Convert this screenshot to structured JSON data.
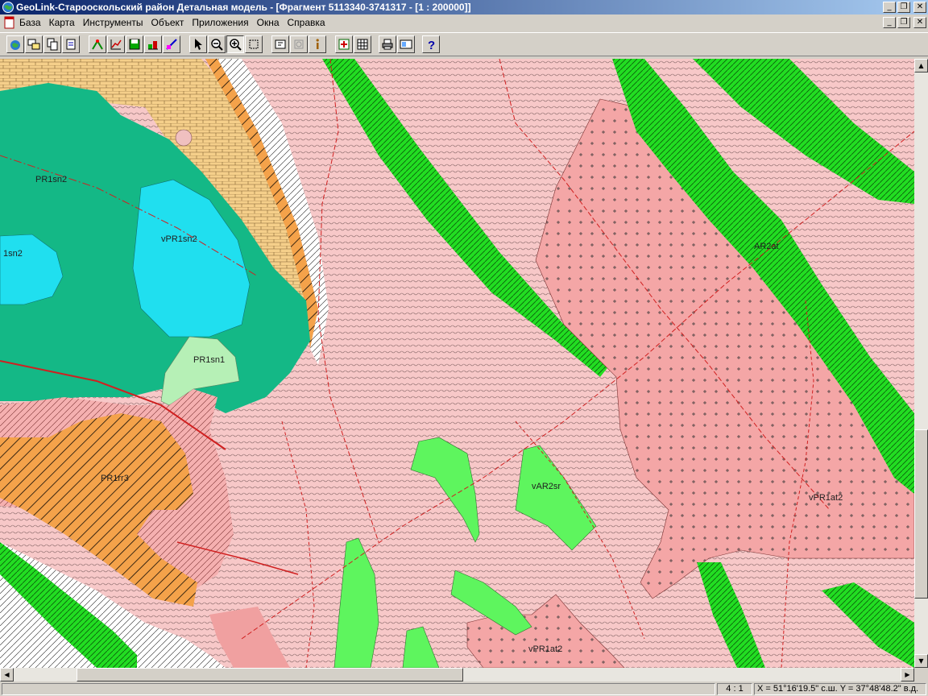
{
  "window": {
    "title": "GeoLink-Старооскольский район Детальная модель - [Фрагмент 5113340-3741317 - [1 : 200000]]",
    "minimize": "_",
    "restore": "❐",
    "close": "✕"
  },
  "menu": {
    "items": [
      "База",
      "Карта",
      "Инструменты",
      "Объект",
      "Приложения",
      "Окна",
      "Справка"
    ]
  },
  "toolbar": {
    "buttons": [
      "open-map-icon",
      "layers-icon",
      "layer-copy-icon",
      "layer-export-icon",
      "edit-object-icon",
      "chart-icon",
      "save-icon",
      "draw-icon",
      "color-edit-icon",
      "pointer-icon",
      "zoom-out-icon",
      "zoom-in-icon",
      "zoom-region-icon",
      "legend-icon",
      "grayed-icon",
      "info-icon",
      "add-window-icon",
      "grid-icon",
      "print-icon",
      "preview-icon",
      "help-icon"
    ]
  },
  "map": {
    "labels": [
      "PR1sn2",
      "vPR1sn2",
      "1sn2",
      "PR1sn1",
      "AR2at",
      "PR1rr3",
      "vAR2sr",
      "vPR1at2",
      "vPR1at2"
    ]
  },
  "statusbar": {
    "scale": "4 : 1",
    "coords": "X = 51°16'19.5\" с.ш.  Y = 37°48'48.2\" в.д."
  }
}
